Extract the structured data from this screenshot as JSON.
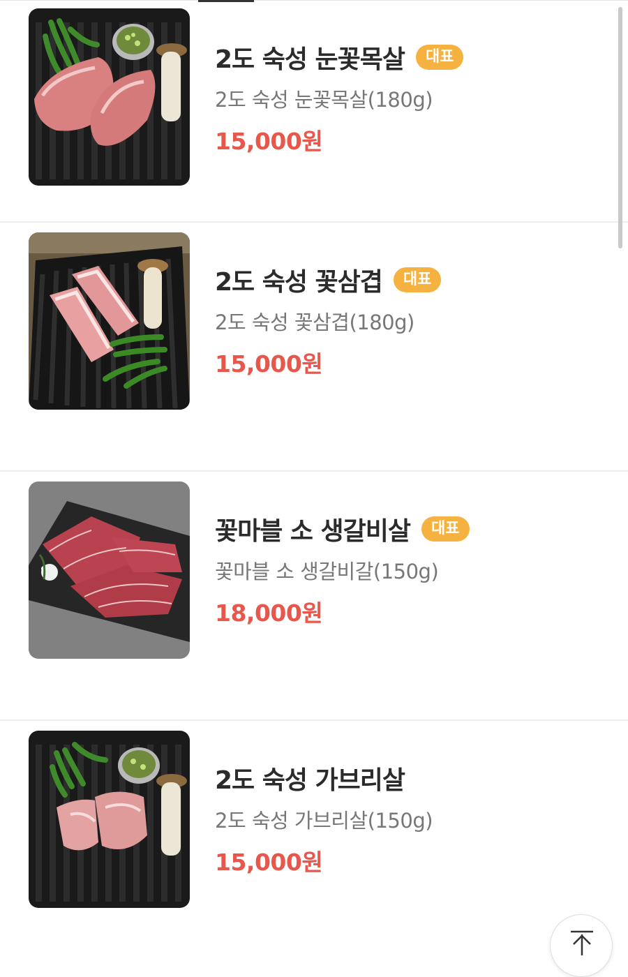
{
  "menu": {
    "items": [
      {
        "name": "2도 숙성 눈꽃목살",
        "badge": "대표",
        "description": "2도 숙성 눈꽃목살(180g)",
        "price": "15,000원",
        "image": "pork-neck-on-grill"
      },
      {
        "name": "2도 숙성 꽃삼겹",
        "badge": "대표",
        "description": "2도 숙성 꽃삼겹(180g)",
        "price": "15,000원",
        "image": "pork-belly-on-grill"
      },
      {
        "name": "꽃마블 소 생갈비살",
        "badge": "대표",
        "description": "꽃마블 소 생갈비갈(150g)",
        "price": "18,000원",
        "image": "beef-rib-on-slate"
      },
      {
        "name": "2도 숙성 가브리살",
        "badge": "",
        "description": "2도 숙성 가브리살(150g)",
        "price": "15,000원",
        "image": "pork-jowl-on-grill"
      }
    ]
  },
  "top_button": {
    "icon": "arrow-up-to-top-icon"
  },
  "colors": {
    "price": "#e8574c",
    "badge": "#f5b240",
    "name": "#2b2b2b",
    "description": "#777777"
  }
}
